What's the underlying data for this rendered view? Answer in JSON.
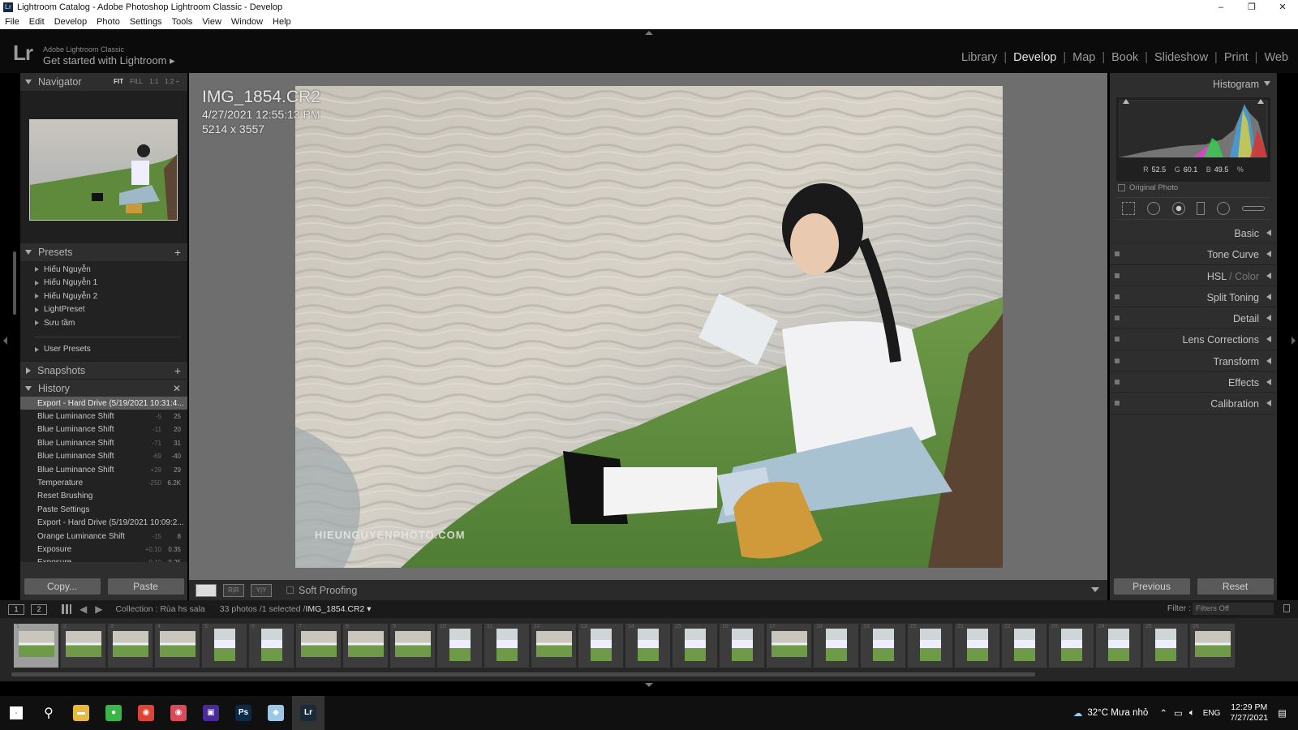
{
  "window": {
    "title": "Lightroom Catalog - Adobe Photoshop Lightroom Classic - Develop",
    "app_icon": "Lr",
    "controls": [
      "–",
      "❐",
      "✕"
    ]
  },
  "menu": [
    "File",
    "Edit",
    "Develop",
    "Photo",
    "Settings",
    "Tools",
    "View",
    "Window",
    "Help"
  ],
  "identity": {
    "logo": "Lr",
    "subtitle": "Adobe Lightroom Classic",
    "get_started": "Get started with Lightroom ▸"
  },
  "modules": [
    {
      "label": "Library",
      "active": false
    },
    {
      "label": "Develop",
      "active": true
    },
    {
      "label": "Map",
      "active": false
    },
    {
      "label": "Book",
      "active": false
    },
    {
      "label": "Slideshow",
      "active": false
    },
    {
      "label": "Print",
      "active": false
    },
    {
      "label": "Web",
      "active": false
    }
  ],
  "navigator": {
    "title": "Navigator",
    "modes": [
      "FIT",
      "FILL",
      "1:1",
      "1:2 ÷"
    ]
  },
  "presets": {
    "title": "Presets",
    "items": [
      "Hiếu Nguyễn",
      "Hiếu Nguyễn 1",
      "Hiếu Nguyễn 2",
      "LightPreset",
      "Sưu tầm"
    ],
    "user": "User Presets"
  },
  "snapshots": {
    "title": "Snapshots"
  },
  "history": {
    "title": "History",
    "items": [
      {
        "label": "Export - Hard Drive (5/19/2021 10:31:4...",
        "v1": "",
        "v2": "",
        "selected": true
      },
      {
        "label": "Blue Luminance Shift",
        "v1": "-5",
        "v2": "25"
      },
      {
        "label": "Blue Luminance Shift",
        "v1": "-11",
        "v2": "20"
      },
      {
        "label": "Blue Luminance Shift",
        "v1": "-71",
        "v2": "31"
      },
      {
        "label": "Blue Luminance Shift",
        "v1": "-69",
        "v2": "-40"
      },
      {
        "label": "Blue Luminance Shift",
        "v1": "+29",
        "v2": "29"
      },
      {
        "label": "Temperature",
        "v1": "-250",
        "v2": "6.2K"
      },
      {
        "label": "Reset Brushing",
        "v1": "",
        "v2": ""
      },
      {
        "label": "Paste Settings",
        "v1": "",
        "v2": ""
      },
      {
        "label": "Export - Hard Drive (5/19/2021 10:09:2...",
        "v1": "",
        "v2": ""
      },
      {
        "label": "Orange Luminance Shift",
        "v1": "-15",
        "v2": "8"
      },
      {
        "label": "Exposure",
        "v1": "+0.10",
        "v2": "0.35"
      },
      {
        "label": "Exposure",
        "v1": "-0.10",
        "v2": "0.25"
      }
    ]
  },
  "left_buttons": {
    "copy": "Copy...",
    "paste": "Paste"
  },
  "photo": {
    "filename": "IMG_1854.CR2",
    "datetime": "4/27/2021 12:55:13 PM",
    "dimensions": "5214 x 3557",
    "watermark": "HIEUNGUYENPHOTO.COM"
  },
  "toolbar": {
    "soft_proofing": "Soft Proofing"
  },
  "histogram": {
    "title": "Histogram",
    "r_label": "R",
    "r": "52.5",
    "g_label": "G",
    "g": "60.1",
    "b_label": "B",
    "b": "49.5",
    "unit": "%",
    "original_photo": "Original Photo"
  },
  "sections": [
    {
      "label": "Basic",
      "switch": false
    },
    {
      "label": "Tone Curve",
      "switch": true
    },
    {
      "label": "HSL",
      "label2": " / Color",
      "switch": true
    },
    {
      "label": "Split Toning",
      "switch": true
    },
    {
      "label": "Detail",
      "switch": true
    },
    {
      "label": "Lens Corrections",
      "switch": true
    },
    {
      "label": "Transform",
      "switch": true
    },
    {
      "label": "Effects",
      "switch": true
    },
    {
      "label": "Calibration",
      "switch": true
    }
  ],
  "right_buttons": {
    "previous": "Previous",
    "reset": "Reset"
  },
  "filmstrip": {
    "screen1": "1",
    "screen2": "2",
    "collection": "Collection : Rùa hs sala",
    "count": "33 photos /1 selected /",
    "current_file": "IMG_1854.CR2 ▾",
    "filter_label": "Filter :",
    "filter_value": "Filters Off",
    "thumbnails": [
      {
        "n": "1",
        "portrait": false,
        "sel": true
      },
      {
        "n": "2",
        "portrait": false
      },
      {
        "n": "3",
        "portrait": false
      },
      {
        "n": "4",
        "portrait": false
      },
      {
        "n": "5",
        "portrait": true
      },
      {
        "n": "6",
        "portrait": true
      },
      {
        "n": "7",
        "portrait": false
      },
      {
        "n": "8",
        "portrait": false
      },
      {
        "n": "9",
        "portrait": false
      },
      {
        "n": "10",
        "portrait": true
      },
      {
        "n": "11",
        "portrait": true
      },
      {
        "n": "12",
        "portrait": false
      },
      {
        "n": "13",
        "portrait": true
      },
      {
        "n": "14",
        "portrait": true
      },
      {
        "n": "15",
        "portrait": true
      },
      {
        "n": "16",
        "portrait": true
      },
      {
        "n": "17",
        "portrait": false
      },
      {
        "n": "18",
        "portrait": true
      },
      {
        "n": "19",
        "portrait": true
      },
      {
        "n": "20",
        "portrait": true
      },
      {
        "n": "21",
        "portrait": true
      },
      {
        "n": "22",
        "portrait": true
      },
      {
        "n": "23",
        "portrait": true
      },
      {
        "n": "24",
        "portrait": true
      },
      {
        "n": "25",
        "portrait": true
      },
      {
        "n": "26",
        "portrait": false
      }
    ]
  },
  "taskbar": {
    "apps": [
      {
        "name": "file-explorer-icon",
        "glyph": "▬",
        "color": "#e8b93a"
      },
      {
        "name": "app-green-icon",
        "glyph": "●",
        "color": "#3bb54a"
      },
      {
        "name": "chrome-icon",
        "glyph": "◉",
        "color": "#db4437"
      },
      {
        "name": "chrome-alt-icon",
        "glyph": "◉",
        "color": "#d94a5a"
      },
      {
        "name": "media-icon",
        "glyph": "▣",
        "color": "#4a2a9a"
      },
      {
        "name": "photoshop-icon",
        "glyph": "Ps",
        "color": "#0b2a4a"
      },
      {
        "name": "notes-icon",
        "glyph": "◆",
        "color": "#9cc8e8"
      },
      {
        "name": "lightroom-icon",
        "glyph": "Lr",
        "color": "#1b2a3a"
      }
    ],
    "weather": "32°C Mưa nhỏ",
    "lang": "ENG",
    "time": "12:29 PM",
    "date": "7/27/2021"
  }
}
